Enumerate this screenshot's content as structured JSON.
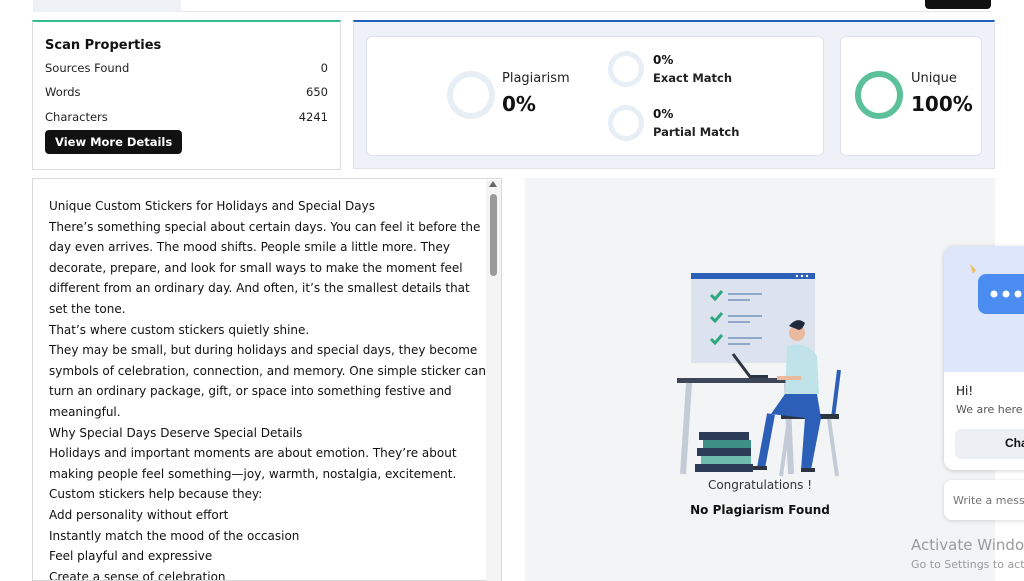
{
  "scan": {
    "title": "Scan Properties",
    "rows": [
      {
        "label": "Sources Found",
        "value": "0"
      },
      {
        "label": "Words",
        "value": "650"
      },
      {
        "label": "Characters",
        "value": "4241"
      }
    ],
    "button": "View More Details"
  },
  "results": {
    "plagiarism_label": "Plagiarism",
    "plagiarism_value": "0%",
    "exact_value": "0%",
    "exact_label": "Exact Match",
    "partial_value": "0%",
    "partial_label": "Partial Match",
    "unique_label": "Unique",
    "unique_value": "100%",
    "unique_fraction": 1.0,
    "colors": {
      "unique_ring": "#5cc09a",
      "empty_ring": "#e8eef6",
      "accent_green": "#2fbf8f",
      "accent_blue": "#1f5fbf"
    }
  },
  "text": {
    "paragraphs": [
      "Unique Custom Stickers for Holidays and Special Days",
      "There’s something special about certain days. You can feel it before the day even arrives. The mood shifts. People smile a little more. They decorate, prepare, and look for small ways to make the moment feel different from an ordinary day. And often, it’s the smallest details that set the tone.",
      "That’s where custom stickers quietly shine.",
      "They may be small, but during holidays and special days, they become symbols of celebration, connection, and memory. One simple sticker can turn an ordinary package, gift, or space into something festive and meaningful.",
      "Why Special Days Deserve Special Details",
      "Holidays and important moments are about emotion. They’re about making people feel something—joy, warmth, nostalgia, excitement.",
      "Custom stickers help because they:",
      "Add personality without effort",
      "Instantly match the mood of the occasion",
      "Feel playful and expressive",
      "Create a sense of celebration"
    ]
  },
  "result_message": {
    "congrats": "Congratulations !",
    "status": "No Plagiarism Found"
  },
  "chat": {
    "greeting": "Hi!",
    "subtext": "We are here f",
    "button": "Cha",
    "input_placeholder": "Write a messa"
  },
  "watermark": {
    "line1": "Activate Windo",
    "line2": "Go to Settings to acti"
  }
}
